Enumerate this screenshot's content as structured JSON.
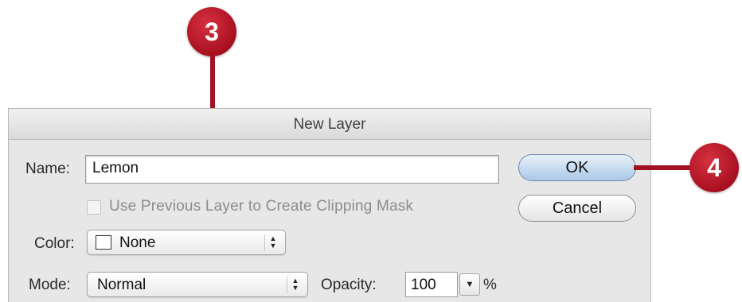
{
  "dialog": {
    "title": "New Layer",
    "name_label": "Name:",
    "name_value": "Lemon",
    "clipping_label": "Use Previous Layer to Create Clipping Mask",
    "clipping_checked": false,
    "clipping_enabled": false,
    "color_label": "Color:",
    "color_value": "None",
    "mode_label": "Mode:",
    "mode_value": "Normal",
    "opacity_label": "Opacity:",
    "opacity_value": "100",
    "opacity_unit": "%",
    "ok_label": "OK",
    "cancel_label": "Cancel"
  },
  "callouts": [
    {
      "number": "3",
      "target": "name-field"
    },
    {
      "number": "4",
      "target": "ok-button"
    }
  ],
  "colors": {
    "callout": "#a81020",
    "default_button": "#aac8e6"
  },
  "icons": {
    "popup_arrows": "updown-arrows-icon",
    "dropdown": "triangle-down-icon"
  }
}
